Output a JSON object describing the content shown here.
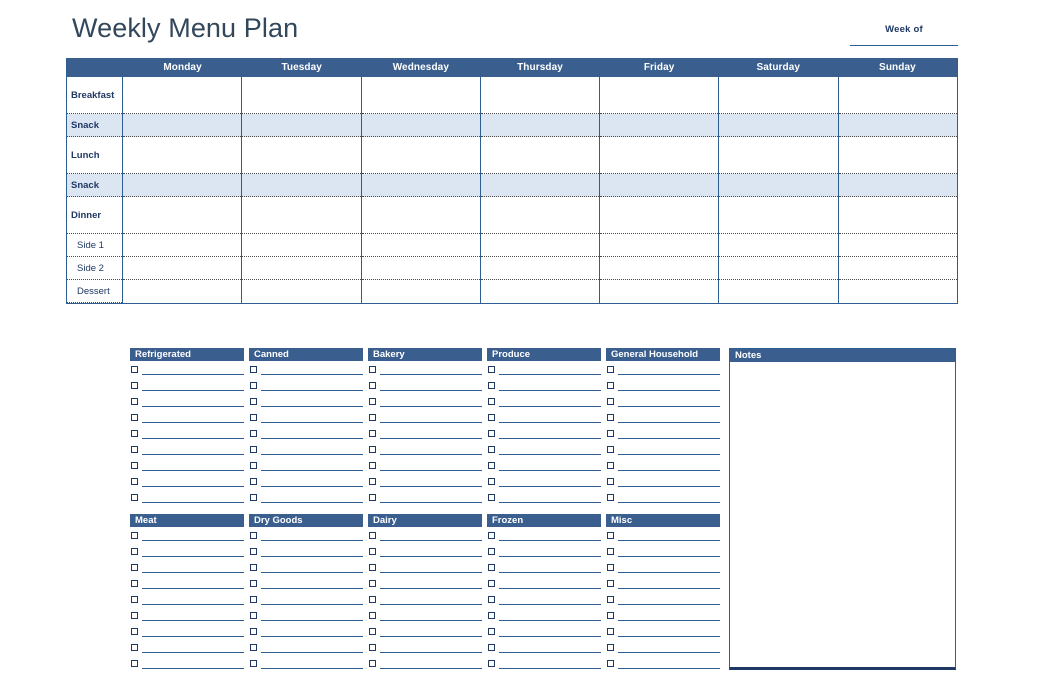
{
  "header": {
    "title": "Weekly Menu Plan",
    "week_of_label": "Week of",
    "week_of_value": ""
  },
  "menu_table": {
    "days": [
      "Monday",
      "Tuesday",
      "Wednesday",
      "Thursday",
      "Friday",
      "Saturday",
      "Sunday"
    ],
    "rows": [
      {
        "label": "Breakfast",
        "size": "big",
        "highlight": false,
        "indent": false
      },
      {
        "label": "Snack",
        "size": "small",
        "highlight": true,
        "indent": false
      },
      {
        "label": "Lunch",
        "size": "big",
        "highlight": false,
        "indent": false
      },
      {
        "label": "Snack",
        "size": "small",
        "highlight": true,
        "indent": false
      },
      {
        "label": "Dinner",
        "size": "big",
        "highlight": false,
        "indent": false
      },
      {
        "label": "Side 1",
        "size": "small",
        "highlight": false,
        "indent": true
      },
      {
        "label": "Side 2",
        "size": "small",
        "highlight": false,
        "indent": true
      },
      {
        "label": "Dessert",
        "size": "small",
        "highlight": false,
        "indent": true
      }
    ]
  },
  "grocery": {
    "rows_per_category": 9,
    "categories_row1": [
      "Refrigerated",
      "Canned",
      "Bakery",
      "Produce",
      "General Household"
    ],
    "categories_row2": [
      "Meat",
      "Dry Goods",
      "Dairy",
      "Frozen",
      "Misc"
    ]
  },
  "notes": {
    "title": "Notes",
    "content": ""
  },
  "colors": {
    "header_blue": "#3a5f8f",
    "border_blue": "#2e5d92",
    "dark_blue": "#1f3864",
    "alt_row": "#dce6f2",
    "title_text": "#33475b"
  }
}
